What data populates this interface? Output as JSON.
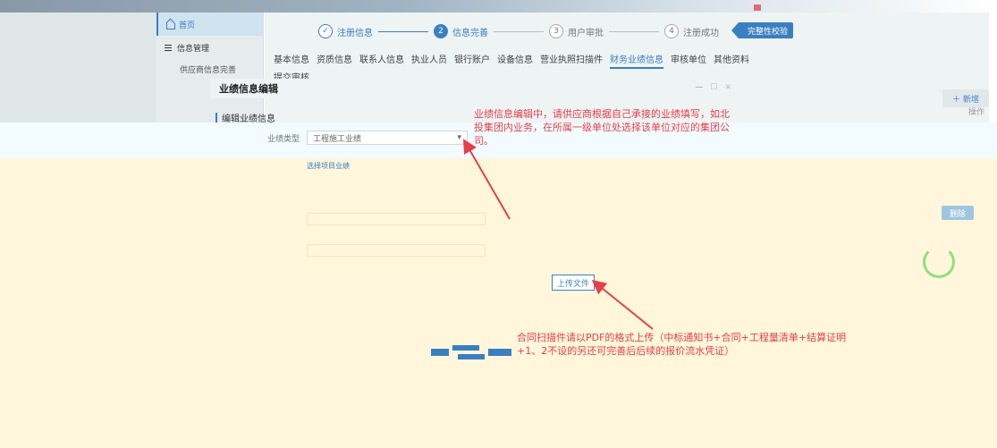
{
  "sidebar": {
    "home": "首页",
    "info_mgmt": "信息管理",
    "supplier_info": "供应商信息完善"
  },
  "steps": [
    {
      "num": "✓",
      "label": "注册信息"
    },
    {
      "num": "2",
      "label": "信息完善"
    },
    {
      "num": "3",
      "label": "用户审批"
    },
    {
      "num": "4",
      "label": "注册成功"
    }
  ],
  "check_button": "完整性校验",
  "tabs": [
    "基本信息",
    "资质信息",
    "联系人信息",
    "执业人员",
    "银行账户",
    "设备信息",
    "营业执照扫描件",
    "财务业绩信息",
    "审核单位",
    "其他资料"
  ],
  "tab_row2": "提交审核",
  "add_button": "新增",
  "op_column": "操作",
  "delete_button": "删除",
  "modal": {
    "title": "业绩信息编辑",
    "controls": [
      "—",
      "☐",
      "✕"
    ],
    "section": "编辑业绩信息",
    "row1_label": "业绩类型",
    "row1_value": "工程施工业绩",
    "row2_link": "选择项目业绩"
  },
  "tip_top": "业绩信息编辑中，请供应商根据自己承接的业绩填写，如北投集团内业务，在所属一级单位处选择该单位对应的集团公司。",
  "tip_bottom": "合同扫描件请以PDF的格式上传（中标通知书+合同+工程量清单+结算证明+1、2不设的另还可完善后后续的报价流水凭证）",
  "upload_button": "上传文件",
  "colors": {
    "accent": "#3a7fc0",
    "tip": "#e5404a",
    "overlay": "#fff6dc"
  }
}
